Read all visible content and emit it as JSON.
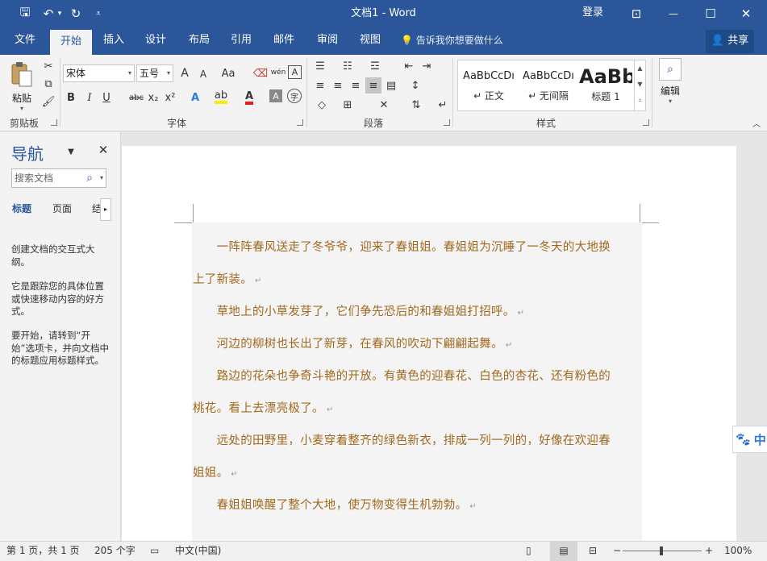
{
  "titlebar": {
    "title": "文档1 - Word",
    "login": "登录",
    "icons": [
      "save-icon",
      "undo-icon",
      "redo-icon",
      "customize-icon",
      "ribbon-display-icon",
      "minimize-icon",
      "maximize-icon",
      "close-icon"
    ],
    "glyphs": {
      "save": "🖫",
      "undo": "↶",
      "undo_arrow": "▾",
      "redo": "↻",
      "customize": "⩡",
      "ribbon_display": "⊡",
      "minimize": "—",
      "maximize": "☐",
      "close": "✕"
    }
  },
  "menu": {
    "tabs": [
      "文件",
      "开始",
      "插入",
      "设计",
      "布局",
      "引用",
      "邮件",
      "审阅",
      "视图"
    ],
    "active": "开始",
    "tell_me": "告诉我你想要做什么",
    "share": "共享"
  },
  "ribbon": {
    "clipboard": {
      "paste_label": "粘贴",
      "group": "剪贴板"
    },
    "font": {
      "font_name": "宋体",
      "font_size": "五号",
      "grow": "A",
      "shrink": "A",
      "case": "Aa",
      "phonetic": "wén",
      "bold": "B",
      "italic": "I",
      "underline": "U",
      "strike": "abc",
      "subscript": "x₂",
      "superscript": "x²",
      "group": "字体"
    },
    "paragraph": {
      "group": "段落"
    },
    "styles": {
      "items": [
        {
          "sample": "AaBbCcDı",
          "name": "↵ 正文"
        },
        {
          "sample": "AaBbCcDı",
          "name": "↵ 无间隔"
        },
        {
          "sample": "AaBb",
          "name": "标题 1"
        }
      ],
      "group": "样式"
    },
    "editing": {
      "label": "编辑"
    }
  },
  "nav": {
    "title": "导航",
    "search_placeholder": "搜索文档",
    "tabs": [
      "标题",
      "页面",
      "结"
    ],
    "text1": "创建文档的交互式大纲。",
    "text2": "它是跟踪您的具体位置或快速移动内容的好方式。",
    "text3": "要开始，请转到“开始”选项卡，并向文档中的标题应用标题样式。"
  },
  "document": {
    "lines": [
      "　　一阵阵春风送走了冬爷爷，迎来了春姐姐。春姐姐为沉睡了一冬天的大地换",
      "上了新装。",
      "　　草地上的小草发芽了，它们争先恐后的和春姐姐打招呼。",
      "　　河边的柳树也长出了新芽，在春风的吹动下翩翩起舞。",
      "　　路边的花朵也争奇斗艳的开放。有黄色的迎春花、白色的杏花、还有粉色的",
      "桃花。看上去漂亮极了。",
      "　　远处的田野里，小麦穿着整齐的绿色新衣，排成一列一列的，好像在欢迎春",
      "姐姐。",
      "　　春姐姐唤醒了整个大地，使万物变得生机勃勃。"
    ],
    "para_mark": "↵"
  },
  "side_tool": {
    "glyph": "🐾",
    "label": "中"
  },
  "status": {
    "page": "第 1 页，共 1 页",
    "words": "205 个字",
    "language": "中文(中国)",
    "zoom": "100%",
    "zoom_minus": "−",
    "zoom_plus": "+"
  },
  "colors": {
    "brand": "#2b579a",
    "doc_text": "#a0691e",
    "share_bg": "#1e4a86"
  }
}
